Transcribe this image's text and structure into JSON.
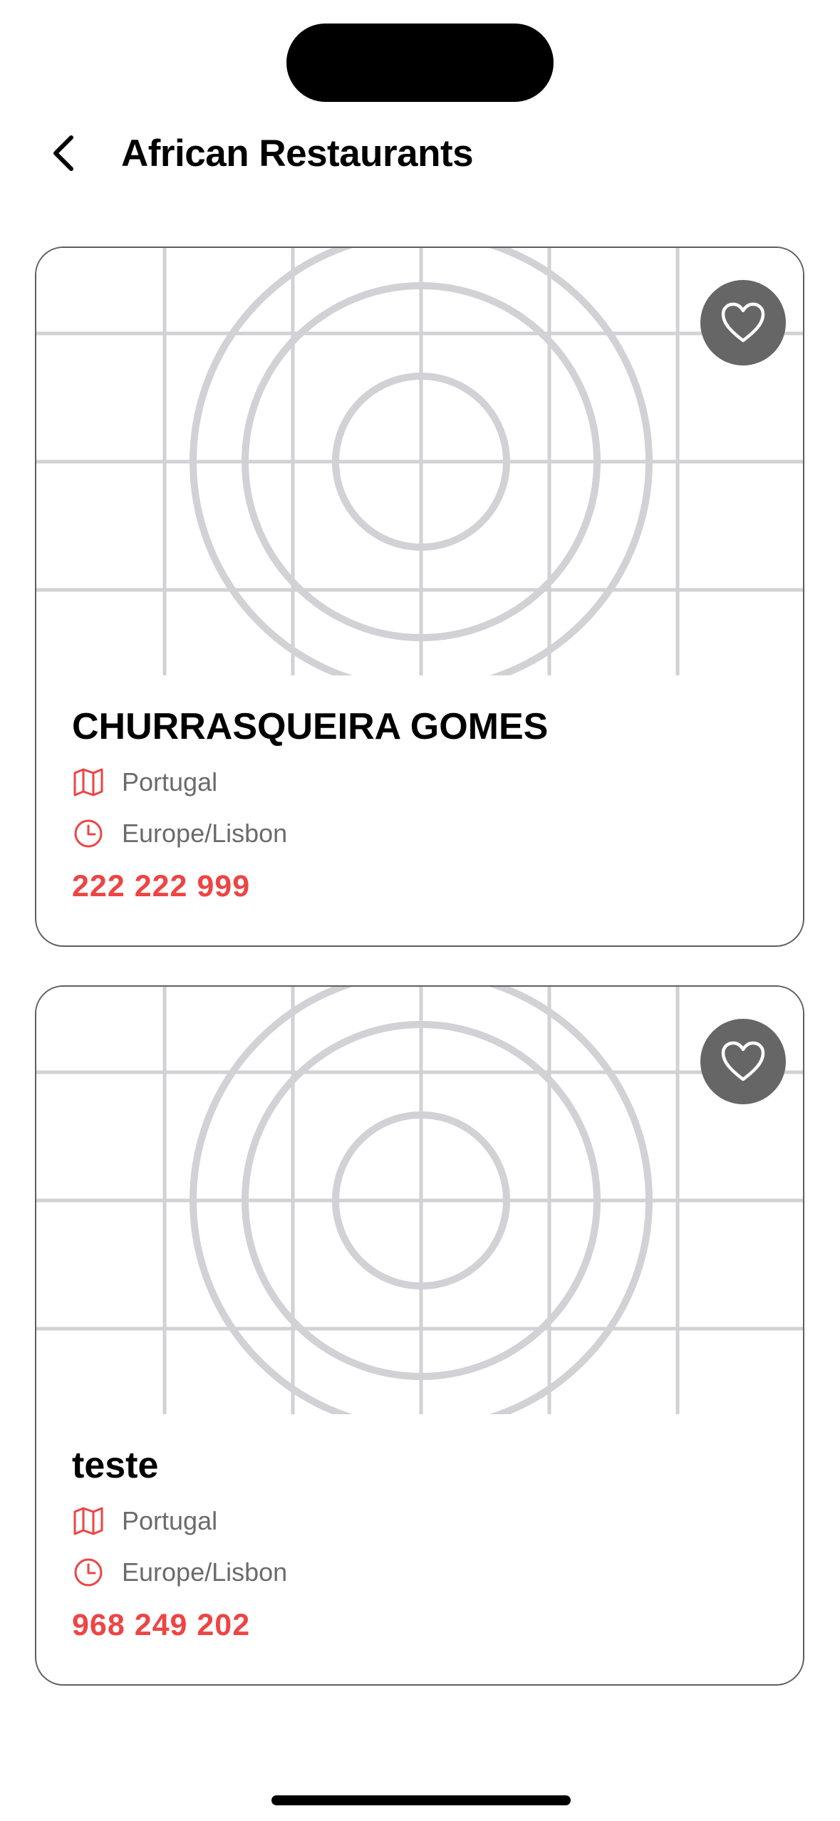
{
  "header": {
    "title": "African Restaurants",
    "back_icon": "chevron-left-icon"
  },
  "colors": {
    "accent": "#ee4444",
    "fav_button_bg": "#666666",
    "placeholder_stroke": "#d1d1d6",
    "card_border": "#5f5f5f",
    "secondary_text": "#6b6b6b"
  },
  "restaurants": [
    {
      "name": "CHURRASQUEIRA GOMES",
      "country": "Portugal",
      "timezone": "Europe/Lisbon",
      "phone": "222 222 999",
      "image": "placeholder-image",
      "favorite_icon": "heart-outline-icon"
    },
    {
      "name": "teste",
      "country": "Portugal",
      "timezone": "Europe/Lisbon",
      "phone": "968 249 202",
      "image": "placeholder-image",
      "favorite_icon": "heart-outline-icon"
    }
  ]
}
